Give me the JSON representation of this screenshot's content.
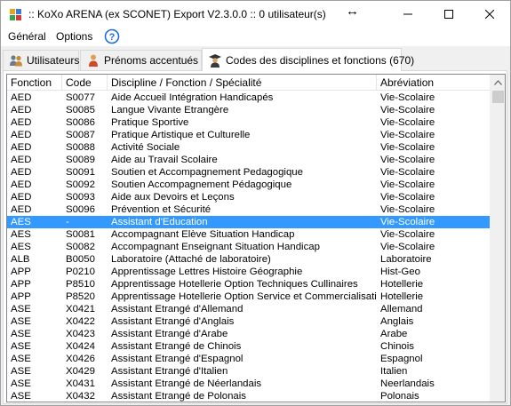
{
  "window": {
    "title": ":: KoXo ARENA (ex SCONET) Export V2.3.0.0 :: 0 utilisateur(s)"
  },
  "menu": {
    "general": "Général",
    "options": "Options"
  },
  "tabs": [
    {
      "label": "Utilisateurs"
    },
    {
      "label": "Prénoms accentués"
    },
    {
      "label": "Codes des disciplines et fonctions (670)"
    }
  ],
  "table": {
    "columns": [
      "Fonction",
      "Code",
      "Discipline / Fonction / Spécialité",
      "Abréviation"
    ],
    "rows": [
      [
        "AED",
        "S0077",
        "Aide Accueil Intégration Handicapés",
        "Vie-Scolaire"
      ],
      [
        "AED",
        "S0085",
        "Langue Vivante Etrangère",
        "Vie-Scolaire"
      ],
      [
        "AED",
        "S0086",
        "Pratique Sportive",
        "Vie-Scolaire"
      ],
      [
        "AED",
        "S0087",
        "Pratique Artistique et Culturelle",
        "Vie-Scolaire"
      ],
      [
        "AED",
        "S0088",
        "Activité Sociale",
        "Vie-Scolaire"
      ],
      [
        "AED",
        "S0089",
        "Aide au Travail Scolaire",
        "Vie-Scolaire"
      ],
      [
        "AED",
        "S0091",
        "Soutien et Accompagnement Pedagogique",
        "Vie-Scolaire"
      ],
      [
        "AED",
        "S0092",
        "Soutien Accompagnement Pédagogique",
        "Vie-Scolaire"
      ],
      [
        "AED",
        "S0093",
        "Aide aux Devoirs et Leçons",
        "Vie-Scolaire"
      ],
      [
        "AED",
        "S0096",
        "Prévention et Sécurité",
        "Vie-Scolaire"
      ],
      [
        "AES",
        "-",
        "Assistant d'Education",
        "Vie-Scolaire"
      ],
      [
        "AES",
        "S0081",
        "Accompagnant Elève Situation Handicap",
        "Vie-Scolaire"
      ],
      [
        "AES",
        "S0082",
        "Accompagnant Enseignant Situation Handicap",
        "Vie-Scolaire"
      ],
      [
        "ALB",
        "B0050",
        "Laboratoire (Attaché de laboratoire)",
        "Laboratoire"
      ],
      [
        "APP",
        "P0210",
        "Apprentissage Lettres Histoire Géographie",
        "Hist-Geo"
      ],
      [
        "APP",
        "P8510",
        "Apprentissage Hotellerie Option Techniques Cullinaires",
        "Hotellerie"
      ],
      [
        "APP",
        "P8520",
        "Apprentissage Hotellerie Option Service et Commercialisation",
        "Hotellerie"
      ],
      [
        "ASE",
        "X0421",
        "Assistant Etrangé d'Allemand",
        "Allemand"
      ],
      [
        "ASE",
        "X0422",
        "Assistant Etrangé d'Anglais",
        "Anglais"
      ],
      [
        "ASE",
        "X0423",
        "Assistant Etrangé d'Arabe",
        "Arabe"
      ],
      [
        "ASE",
        "X0424",
        "Assistant Etrangé de Chinois",
        "Chinois"
      ],
      [
        "ASE",
        "X0426",
        "Assistant Etrangé d'Espagnol",
        "Espagnol"
      ],
      [
        "ASE",
        "X0429",
        "Assistant Etrangé d'Italien",
        "Italien"
      ],
      [
        "ASE",
        "X0431",
        "Assistant Etrangé de Néerlandais",
        "Neerlandais"
      ],
      [
        "ASE",
        "X0432",
        "Assistant Etrangé de Polonais",
        "Polonais"
      ]
    ],
    "selected_row_index": 10
  },
  "colors": {
    "selection": "#3399ff",
    "help_icon": "#1e6fd9"
  },
  "icons": {
    "app": "koxo-app-icon",
    "help": "help-question-icon",
    "users_tab": "users-icon",
    "prenoms_tab": "person-icon",
    "codes_tab": "teacher-icon"
  }
}
